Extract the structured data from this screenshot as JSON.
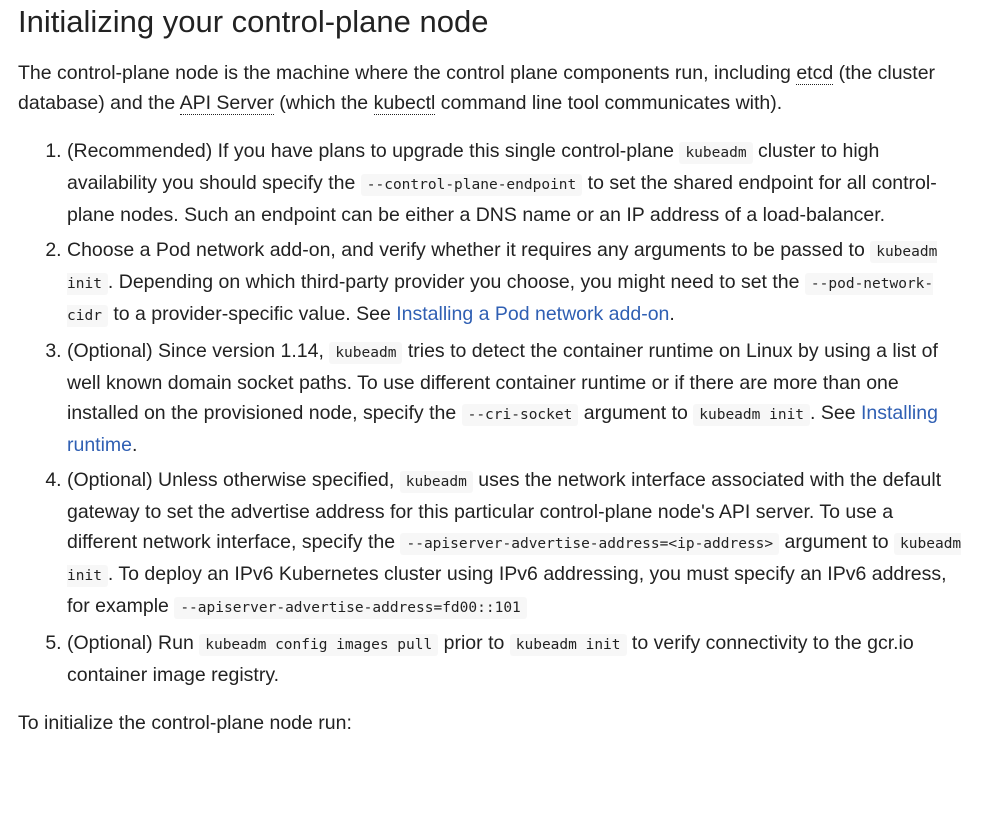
{
  "heading": "Initializing your control-plane node",
  "intro": {
    "t1": "The control-plane node is the machine where the control plane components run, including ",
    "etcd": "etcd",
    "t2": " (the cluster database) and the ",
    "api_server": "API Server",
    "t3": " (which the ",
    "kubectl": "kubectl",
    "t4": " command line tool communicates with)."
  },
  "steps": [
    {
      "a": "(Recommended) If you have plans to upgrade this single control-plane ",
      "c1": "kubeadm",
      "b": " cluster to high availability you should specify the ",
      "c2": "--control-plane-endpoint",
      "c": " to set the shared endpoint for all control-plane nodes. Such an endpoint can be either a DNS name or an IP address of a load-balancer."
    },
    {
      "a": "Choose a Pod network add-on, and verify whether it requires any arguments to be passed to ",
      "c1": "kubeadm init",
      "b": ". Depending on which third-party provider you choose, you might need to set the ",
      "c2": "--pod-network-cidr",
      "c": " to a provider-specific value. See ",
      "link": "Installing a Pod network add-on",
      "d": "."
    },
    {
      "a": "(Optional) Since version 1.14, ",
      "c1": "kubeadm",
      "b": " tries to detect the container runtime on Linux by using a list of well known domain socket paths. To use different container runtime or if there are more than one installed on the provisioned node, specify the ",
      "c2": "--cri-socket",
      "c": " argument to ",
      "c3": "kubeadm init",
      "d": ". See ",
      "link": "Installing runtime",
      "e": "."
    },
    {
      "a": "(Optional) Unless otherwise specified, ",
      "c1": "kubeadm",
      "b": " uses the network interface associated with the default gateway to set the advertise address for this particular control-plane node's API server. To use a different network interface, specify the ",
      "c2": "--apiserver-advertise-address=<ip-address>",
      "c": " argument to ",
      "c3": "kubeadm init",
      "d": ". To deploy an IPv6 Kubernetes cluster using IPv6 addressing, you must specify an IPv6 address, for example ",
      "c4": "--apiserver-advertise-address=fd00::101"
    },
    {
      "a": "(Optional) Run ",
      "c1": "kubeadm config images pull",
      "b": " prior to ",
      "c2": "kubeadm init",
      "c": " to verify connectivity to the gcr.io container image registry."
    }
  ],
  "outro": "To initialize the control-plane node run:"
}
